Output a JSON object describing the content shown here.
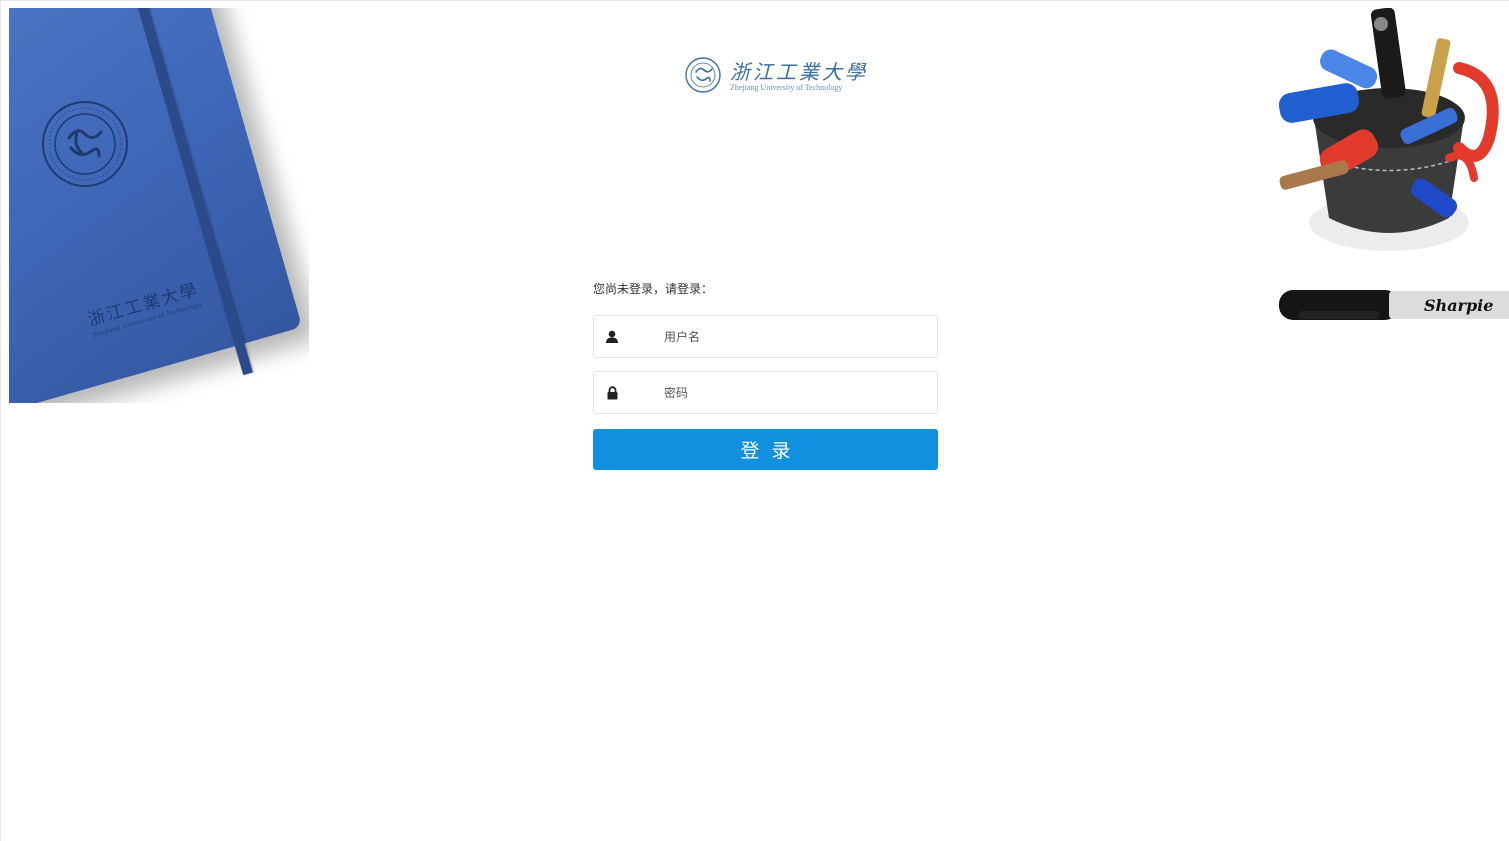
{
  "logo": {
    "name_cn": "浙江工業大學",
    "name_en": "Zhejiang University of Technology",
    "icon": "university-seal-icon"
  },
  "decor": {
    "notebook_cn": "浙江工業大學",
    "notebook_en": "Zhejiang University of Technology",
    "marker_brand": "Sharpie"
  },
  "login": {
    "notice": "您尚未登录，请登录：",
    "username_placeholder": "用户名",
    "password_placeholder": "密码",
    "username_icon": "user-icon",
    "password_icon": "lock-icon",
    "submit_label": "登录"
  },
  "colors": {
    "button": "#1290e0",
    "logo": "#3c6fa0",
    "notebook": "#3f67b8"
  }
}
